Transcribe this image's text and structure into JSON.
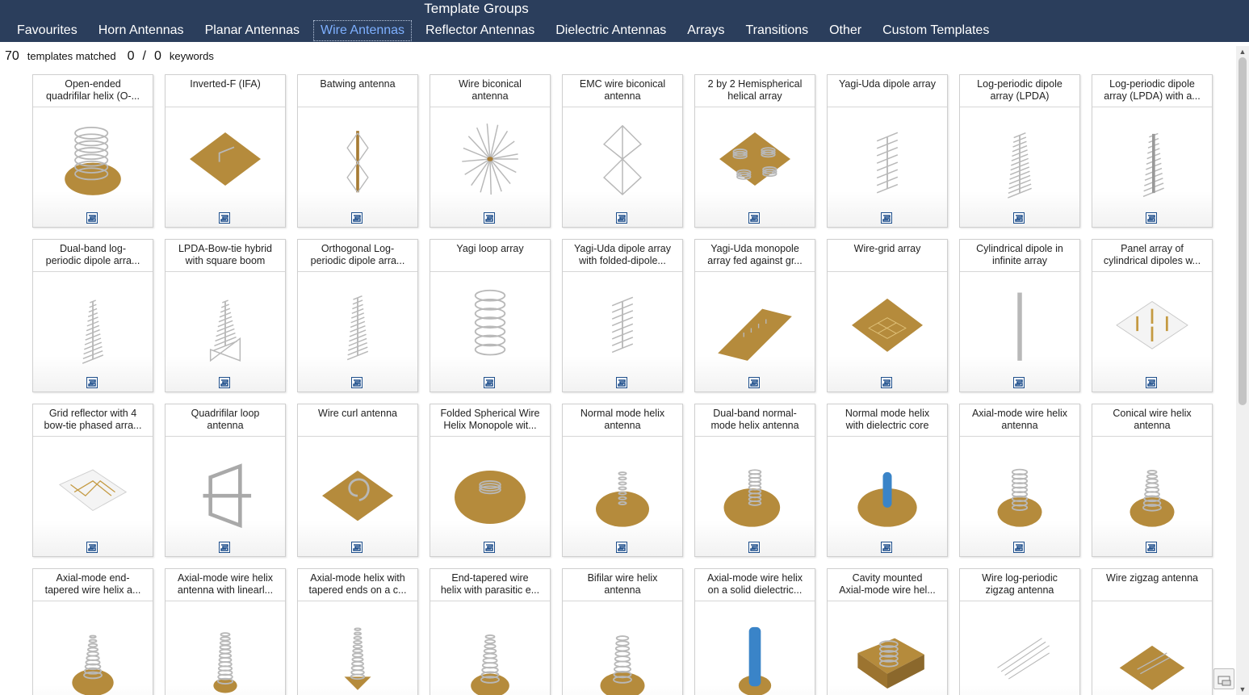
{
  "header": {
    "title": "Template Groups",
    "tabs": [
      {
        "label": "Favourites",
        "active": false
      },
      {
        "label": "Horn Antennas",
        "active": false
      },
      {
        "label": "Planar Antennas",
        "active": false
      },
      {
        "label": "Wire Antennas",
        "active": true
      },
      {
        "label": "Reflector Antennas",
        "active": false
      },
      {
        "label": "Dielectric Antennas",
        "active": false
      },
      {
        "label": "Arrays",
        "active": false
      },
      {
        "label": "Transitions",
        "active": false
      },
      {
        "label": "Other",
        "active": false
      },
      {
        "label": "Custom Templates",
        "active": false
      }
    ]
  },
  "status": {
    "matched_count": "70",
    "matched_label": "templates matched",
    "keywords_found": "0",
    "separator": "/",
    "keywords_total": "0",
    "keywords_label": "keywords"
  },
  "colors": {
    "header_bg": "#2b3e5c",
    "active_tab": "#7eb0ff",
    "ground": "#b58b3c",
    "wire": "#b8b8b8",
    "dielectric": "#3a84c8",
    "logo": "#1e4f8c"
  },
  "templates": [
    {
      "line1": "Open-ended",
      "line2": "quadrifilar helix (O-...",
      "icon": "quadrifilar-helix-on-disk-icon"
    },
    {
      "line1": "Inverted-F (IFA)",
      "line2": "",
      "icon": "inverted-f-on-plate-icon"
    },
    {
      "line1": "Batwing antenna",
      "line2": "",
      "icon": "batwing-mast-icon"
    },
    {
      "line1": "Wire biconical",
      "line2": "antenna",
      "icon": "wire-biconical-icon"
    },
    {
      "line1": "EMC wire biconical",
      "line2": "antenna",
      "icon": "emc-biconical-icon"
    },
    {
      "line1": "2 by 2 Hemispherical",
      "line2": "helical array",
      "icon": "hemispherical-helix-array-icon"
    },
    {
      "line1": "Yagi-Uda dipole array",
      "line2": "",
      "icon": "yagi-uda-icon"
    },
    {
      "line1": "Log-periodic dipole",
      "line2": "array (LPDA)",
      "icon": "lpda-icon"
    },
    {
      "line1": "Log-periodic dipole",
      "line2": "array (LPDA) with a...",
      "icon": "lpda-boom-icon"
    },
    {
      "line1": "Dual-band log-",
      "line2": "periodic dipole arra...",
      "icon": "dual-band-lpda-icon"
    },
    {
      "line1": "LPDA-Bow-tie hybrid",
      "line2": "with square boom",
      "icon": "lpda-bowtie-icon"
    },
    {
      "line1": "Orthogonal Log-",
      "line2": "periodic dipole arra...",
      "icon": "orthogonal-lpda-icon"
    },
    {
      "line1": "Yagi loop array",
      "line2": "",
      "icon": "yagi-loop-icon"
    },
    {
      "line1": "Yagi-Uda dipole array",
      "line2": "with folded-dipole...",
      "icon": "yagi-folded-dipole-icon"
    },
    {
      "line1": "Yagi-Uda monopole",
      "line2": "array fed against gr...",
      "icon": "yagi-monopole-plate-icon"
    },
    {
      "line1": "Wire-grid array",
      "line2": "",
      "icon": "wire-grid-plate-icon"
    },
    {
      "line1": "Cylindrical dipole in",
      "line2": "infinite array",
      "icon": "cylindrical-dipole-icon"
    },
    {
      "line1": "Panel array of",
      "line2": "cylindrical dipoles w...",
      "icon": "panel-array-icon"
    },
    {
      "line1": "Grid reflector with 4",
      "line2": "bow-tie phased arra...",
      "icon": "grid-reflector-icon"
    },
    {
      "line1": "Quadrifilar loop",
      "line2": "antenna",
      "icon": "quadrifilar-loop-icon"
    },
    {
      "line1": "Wire curl antenna",
      "line2": "",
      "icon": "wire-curl-icon"
    },
    {
      "line1": "Folded Spherical Wire",
      "line2": "Helix Monopole wit...",
      "icon": "folded-spherical-helix-icon"
    },
    {
      "line1": "Normal mode helix",
      "line2": "antenna",
      "icon": "normal-helix-icon"
    },
    {
      "line1": "Dual-band normal-",
      "line2": "mode helix antenna",
      "icon": "dual-band-helix-icon"
    },
    {
      "line1": "Normal mode helix",
      "line2": "with dielectric core",
      "icon": "helix-dielectric-core-icon"
    },
    {
      "line1": "Axial-mode wire helix",
      "line2": "antenna",
      "icon": "axial-helix-icon"
    },
    {
      "line1": "Conical wire helix",
      "line2": "antenna",
      "icon": "conical-helix-icon"
    },
    {
      "line1": "Axial-mode end-",
      "line2": "tapered wire helix a...",
      "icon": "end-tapered-helix-icon"
    },
    {
      "line1": "Axial-mode wire helix",
      "line2": "antenna with linearl...",
      "icon": "linear-tapered-helix-icon"
    },
    {
      "line1": "Axial-mode helix with",
      "line2": "tapered ends on a c...",
      "icon": "tapered-helix-cone-icon"
    },
    {
      "line1": "End-tapered wire",
      "line2": "helix with parasitic e...",
      "icon": "parasitic-helix-icon"
    },
    {
      "line1": "Bifilar wire helix",
      "line2": "antenna",
      "icon": "bifilar-helix-icon"
    },
    {
      "line1": "Axial-mode wire helix",
      "line2": "on a solid dielectric...",
      "icon": "helix-solid-dielectric-icon"
    },
    {
      "line1": "Cavity mounted",
      "line2": "Axial-mode wire hel...",
      "icon": "cavity-helix-icon"
    },
    {
      "line1": "Wire log-periodic",
      "line2": "zigzag antenna",
      "icon": "log-periodic-zigzag-icon"
    },
    {
      "line1": "Wire zigzag antenna",
      "line2": "",
      "icon": "wire-zigzag-icon"
    }
  ]
}
